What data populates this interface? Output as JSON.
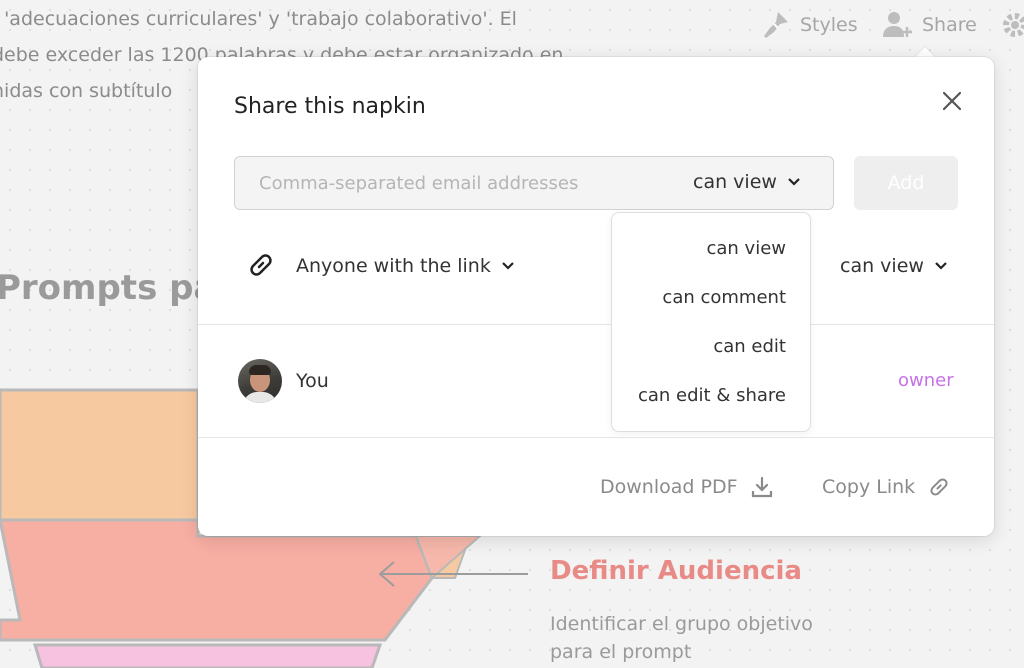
{
  "background": {
    "text_lines": [
      ", 'adecuaciones curriculares' y 'trabajo colaborativo'. El",
      "debe exceder las 1200 palabras y debe estar organizado en",
      "nidas con subtítulo"
    ],
    "heading": "Prompts par",
    "definir_audiencia": {
      "title": "Definir Audiencia",
      "description": "Identificar el grupo objetivo para el prompt"
    },
    "colors": {
      "orange": "#f6c9a1",
      "salmon": "#f7aea3",
      "pink": "#f7c2df",
      "accent": "#e88b86"
    }
  },
  "toolbar": {
    "styles_label": "Styles",
    "share_label": "Share",
    "icons": [
      "styles-icon",
      "share-user-icon",
      "settings-gear-icon"
    ]
  },
  "share_dialog": {
    "title": "Share this napkin",
    "email_placeholder": "Comma-separated email addresses",
    "email_value": "",
    "email_permission": "can view",
    "add_label": "Add",
    "link_access_label": "Anyone with the link",
    "link_permission": "can view",
    "permission_menu": [
      "can view",
      "can comment",
      "can edit",
      "can edit & share"
    ],
    "members": [
      {
        "name": "You",
        "role": "owner"
      }
    ],
    "download_pdf_label": "Download PDF",
    "copy_link_label": "Copy Link",
    "colors": {
      "owner": "#c772e8",
      "add_button_bg": "#eeeeee"
    }
  }
}
